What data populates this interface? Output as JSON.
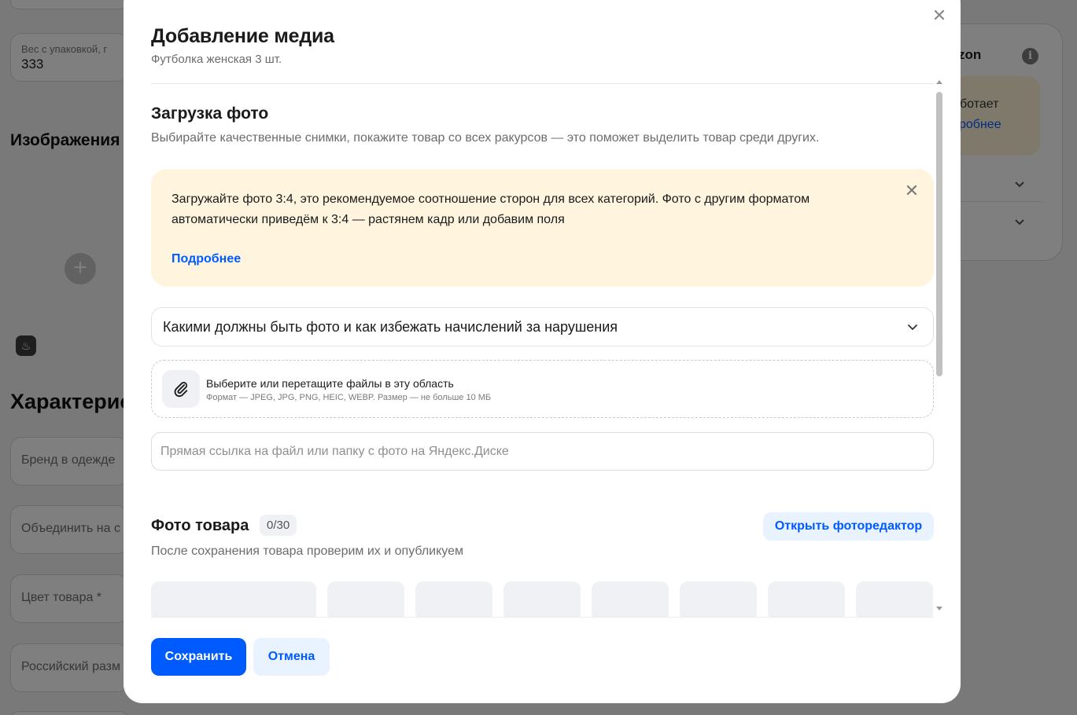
{
  "background": {
    "weight_label": "Вес с упаковкой, г",
    "weight_value": "333",
    "images_heading": "Изображения",
    "characteristics_heading": "Характерис",
    "fields": [
      "Бренд в одежде",
      "Объединить на с",
      "Цвет товара *",
      "Российский разм"
    ],
    "right_card_title": "zon",
    "right_card_text": "ботает",
    "right_card_link": "робнее"
  },
  "modal": {
    "title": "Добавление медиа",
    "subtitle": "Футболка женская 3 шт.",
    "upload_section": {
      "title": "Загрузка фото",
      "description": "Выбирайте качественные снимки, покажите товар со всех ракурсов —  это поможет выделить товар среди других."
    },
    "notice": {
      "text": "Загружайте фото 3:4, это рекомендуемое соотношение сторон для всех категорий. Фото с другим форматом автоматически приведём к 3:4 — растянем кадр или добавим поля",
      "link": "Подробнее"
    },
    "accordion": {
      "label": "Какими должны быть фото и как избежать начислений за нарушения"
    },
    "dropzone": {
      "title": "Выберите или перетащите файлы в эту область",
      "description": "Формат — JPEG, JPG, PNG, HEIC, WEBP. Размер — не больше 10 МБ"
    },
    "link_input": {
      "placeholder": "Прямая ссылка на файл или папку с фото на Яндекс.Диске",
      "value": ""
    },
    "photos": {
      "title": "Фото товара",
      "count": "0/30",
      "editor_button": "Открыть фоторедактор",
      "description": "После сохранения товара проверим их и опубликуем"
    },
    "buttons": {
      "save": "Сохранить",
      "cancel": "Отмена"
    }
  },
  "colors": {
    "accent": "#005bff",
    "accent_light": "#e8f3ff",
    "notice_bg": "#fff5de"
  },
  "icons": [
    "close-icon",
    "chevron-down-icon",
    "paperclip-icon",
    "plus-icon",
    "info-icon",
    "fire-icon"
  ]
}
